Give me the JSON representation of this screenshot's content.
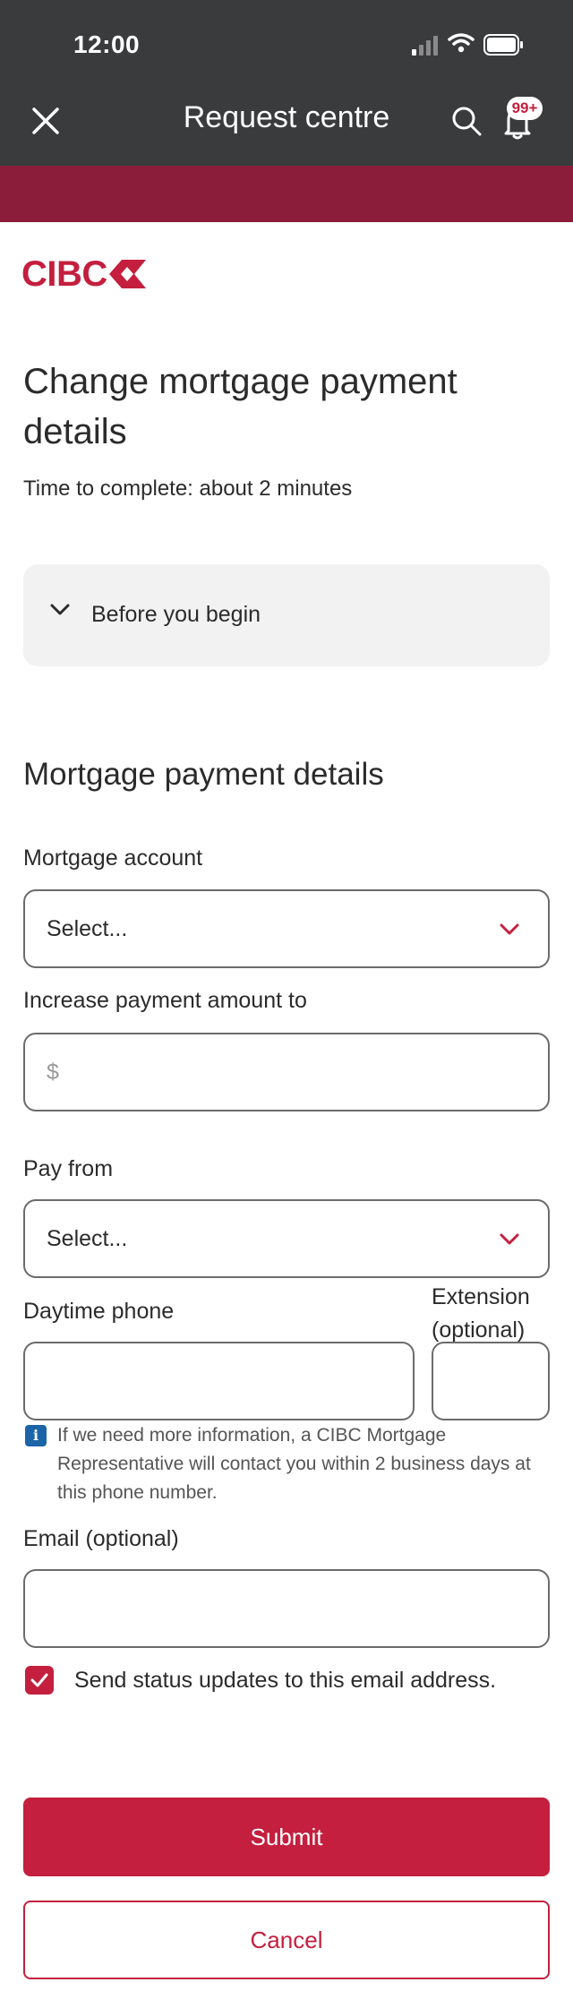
{
  "status_bar": {
    "time": "12:00"
  },
  "header": {
    "title": "Request centre",
    "notification_badge": "99+",
    "icons": [
      "close-icon",
      "search-icon",
      "bell-icon"
    ]
  },
  "brand": {
    "logo_text": "CIBC",
    "accent_color": "#c41f3e",
    "strip_color": "#8b1d3b"
  },
  "page": {
    "title": "Change mortgage payment details",
    "time_to_complete": "Time to complete: about 2 minutes"
  },
  "before_you_begin": {
    "label": "Before you begin"
  },
  "form": {
    "section_title": "Mortgage payment details",
    "mortgage_account": {
      "label": "Mortgage account",
      "value": "Select..."
    },
    "increase_payment": {
      "label": "Increase payment amount to",
      "placeholder": "$"
    },
    "pay_from": {
      "label": "Pay from",
      "value": "Select..."
    },
    "daytime_phone": {
      "label": "Daytime phone"
    },
    "extension": {
      "label": "Extension (optional)"
    },
    "phone_info": "If we need more information, a CIBC Mortgage Representative will contact you within 2 business days at this phone number.",
    "email": {
      "label": "Email (optional)"
    },
    "status_updates": {
      "label": "Send status updates to this email address.",
      "checked": true
    }
  },
  "actions": {
    "submit_label": "Submit",
    "cancel_label": "Cancel"
  }
}
